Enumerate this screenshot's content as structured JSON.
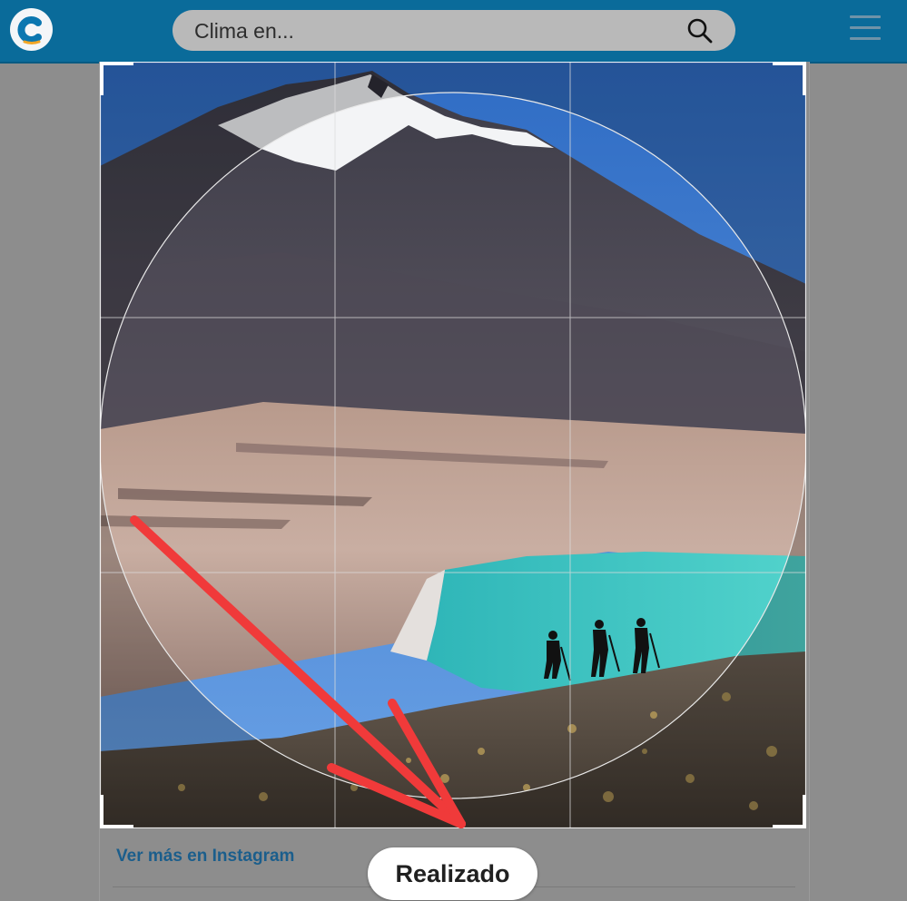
{
  "header": {
    "logo_icon": "weather-site-c-logo",
    "search": {
      "placeholder": "Clima en...",
      "value": ""
    },
    "search_icon": "search-icon",
    "menu_icon": "hamburger-menu-icon"
  },
  "card": {
    "instagram_link": "Ver más en Instagram"
  },
  "crop_editor": {
    "shape": "circle",
    "grid": "3x3",
    "image_subject": "snow-capped volcano, desert plain, turquoise lagoon, three hikers on rocky slope",
    "annotation": "red arrow pointing to done button"
  },
  "done_button": {
    "label": "Realizado"
  },
  "colors": {
    "topbar": "#0a6b9a",
    "search_bg": "#b9b9b9",
    "link": "#1b5e8c",
    "annotation_arrow": "#f03a3a",
    "lagoon": "#3fc6c4"
  }
}
